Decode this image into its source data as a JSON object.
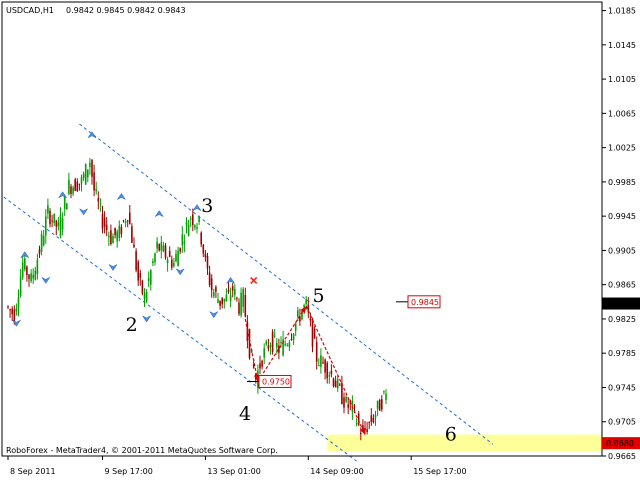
{
  "header": {
    "symbol": "USDCAD,H1",
    "ohlc": "0.9842 0.9845 0.9842 0.9843"
  },
  "footer": {
    "copyright": "RoboForex - MetaTrader4, © 2001-2011 MetaQuotes Software Corp."
  },
  "colors": {
    "bull": "#00a000",
    "bear": "#a00000",
    "channel": "#1e6fd9",
    "arrow": "#dd0000",
    "target_zone": "#ffff99",
    "current_price_box": "#000000"
  },
  "icons": [
    "fractal-arrow-icon",
    "cross-marker-icon"
  ],
  "chart_data": {
    "type": "candlestick",
    "symbol": "USDCAD",
    "timeframe": "H1",
    "ylim": [
      0.9665,
      1.0195
    ],
    "y_ticks": [
      "1.0185",
      "1.0145",
      "1.0105",
      "1.0065",
      "1.0025",
      "0.9985",
      "0.9945",
      "0.9905",
      "0.9865",
      "0.9825",
      "0.9785",
      "0.9745",
      "0.9705",
      "0.9665"
    ],
    "x_ticks": [
      {
        "label": "8 Sep 2011",
        "bar": 0
      },
      {
        "label": "9 Sep 17:00",
        "bar": 45
      },
      {
        "label": "13 Sep 01:00",
        "bar": 94
      },
      {
        "label": "14 Sep 09:00",
        "bar": 143
      },
      {
        "label": "15 Sep 17:00",
        "bar": 192
      }
    ],
    "current_price": "0.9843",
    "price_labels": [
      {
        "text": "0.9845",
        "price": 0.9845
      },
      {
        "text": "0.9750",
        "price": 0.9752
      }
    ],
    "target_zone": {
      "label": "0.9680",
      "from": 0.967,
      "to": 0.969
    },
    "wave_labels": [
      {
        "text": "2",
        "bar": 56,
        "price": 0.9818
      },
      {
        "text": "3",
        "bar": 92,
        "price": 0.9957
      },
      {
        "text": "4",
        "bar": 110,
        "price": 0.9714
      },
      {
        "text": "5",
        "bar": 145,
        "price": 0.9852
      },
      {
        "text": "6",
        "bar": 208,
        "price": 0.969
      }
    ],
    "channel_lines": [
      {
        "p1": {
          "bar": 38,
          "price": 1.0045
        },
        "p2": {
          "bar": 225,
          "price": 0.969
        }
      },
      {
        "p1": {
          "bar": 2,
          "price": 0.996
        },
        "p2": {
          "bar": 160,
          "price": 0.967
        }
      }
    ],
    "forecast_path": [
      {
        "bar": 113,
        "price": 0.9825
      },
      {
        "bar": 119,
        "price": 0.9752
      },
      {
        "bar": 142,
        "price": 0.984
      },
      {
        "bar": 170,
        "price": 0.969
      }
    ],
    "price_path": [
      {
        "bar": 0,
        "price": 0.984
      },
      {
        "bar": 4,
        "price": 0.983
      },
      {
        "bar": 8,
        "price": 0.989
      },
      {
        "bar": 12,
        "price": 0.987
      },
      {
        "bar": 16,
        "price": 0.9905
      },
      {
        "bar": 20,
        "price": 0.995
      },
      {
        "bar": 25,
        "price": 0.993
      },
      {
        "bar": 30,
        "price": 0.998
      },
      {
        "bar": 36,
        "price": 0.9985
      },
      {
        "bar": 40,
        "price": 1.001
      },
      {
        "bar": 42,
        "price": 0.9975
      },
      {
        "bar": 46,
        "price": 0.994
      },
      {
        "bar": 50,
        "price": 0.992
      },
      {
        "bar": 54,
        "price": 0.9925
      },
      {
        "bar": 58,
        "price": 0.995
      },
      {
        "bar": 60,
        "price": 0.992
      },
      {
        "bar": 63,
        "price": 0.987
      },
      {
        "bar": 66,
        "price": 0.985
      },
      {
        "bar": 68,
        "price": 0.987
      },
      {
        "bar": 72,
        "price": 0.991
      },
      {
        "bar": 76,
        "price": 0.99
      },
      {
        "bar": 80,
        "price": 0.989
      },
      {
        "bar": 84,
        "price": 0.992
      },
      {
        "bar": 88,
        "price": 0.9945
      },
      {
        "bar": 92,
        "price": 0.9935
      },
      {
        "bar": 95,
        "price": 0.989
      },
      {
        "bar": 98,
        "price": 0.986
      },
      {
        "bar": 102,
        "price": 0.9845
      },
      {
        "bar": 106,
        "price": 0.985
      },
      {
        "bar": 108,
        "price": 0.986
      },
      {
        "bar": 111,
        "price": 0.984
      },
      {
        "bar": 113,
        "price": 0.985
      },
      {
        "bar": 116,
        "price": 0.979
      },
      {
        "bar": 119,
        "price": 0.9755
      },
      {
        "bar": 122,
        "price": 0.978
      },
      {
        "bar": 126,
        "price": 0.98
      },
      {
        "bar": 130,
        "price": 0.979
      },
      {
        "bar": 134,
        "price": 0.98
      },
      {
        "bar": 138,
        "price": 0.982
      },
      {
        "bar": 141,
        "price": 0.9835
      },
      {
        "bar": 143,
        "price": 0.984
      },
      {
        "bar": 145,
        "price": 0.9815
      },
      {
        "bar": 148,
        "price": 0.978
      },
      {
        "bar": 152,
        "price": 0.977
      },
      {
        "bar": 155,
        "price": 0.976
      },
      {
        "bar": 159,
        "price": 0.974
      },
      {
        "bar": 162,
        "price": 0.9725
      },
      {
        "bar": 165,
        "price": 0.972
      },
      {
        "bar": 168,
        "price": 0.97
      },
      {
        "bar": 170,
        "price": 0.969
      },
      {
        "bar": 172,
        "price": 0.97
      },
      {
        "bar": 175,
        "price": 0.971
      },
      {
        "bar": 178,
        "price": 0.9725
      },
      {
        "bar": 180,
        "price": 0.9735
      }
    ],
    "fractals_up": [
      {
        "bar": 8,
        "price": 0.99
      },
      {
        "bar": 26,
        "price": 0.997
      },
      {
        "bar": 40,
        "price": 1.004
      },
      {
        "bar": 54,
        "price": 0.9968
      },
      {
        "bar": 72,
        "price": 0.9948
      },
      {
        "bar": 90,
        "price": 0.9955
      },
      {
        "bar": 106,
        "price": 0.987
      }
    ],
    "fractals_down": [
      {
        "bar": 4,
        "price": 0.982
      },
      {
        "bar": 18,
        "price": 0.987
      },
      {
        "bar": 36,
        "price": 0.995
      },
      {
        "bar": 50,
        "price": 0.9885
      },
      {
        "bar": 66,
        "price": 0.9825
      },
      {
        "bar": 82,
        "price": 0.988
      },
      {
        "bar": 98,
        "price": 0.983
      }
    ],
    "cross_marker": {
      "bar": 117,
      "price": 0.987
    }
  }
}
